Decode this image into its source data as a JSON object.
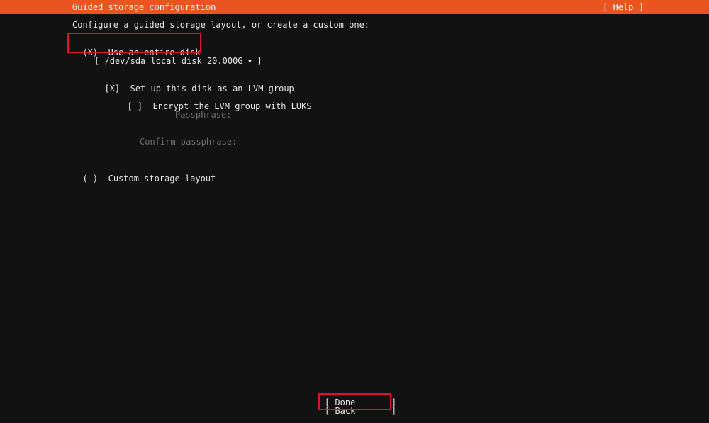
{
  "header": {
    "title": "Guided storage configuration",
    "help_label": "[ Help ]"
  },
  "intro": "Configure a guided storage layout, or create a custom one:",
  "options": {
    "entire_disk": {
      "radio": "(X)",
      "label": "Use an entire disk"
    },
    "disk_select": {
      "open": "[",
      "value": "/dev/sda local disk 20.000G",
      "caret": "▼",
      "close": "]"
    },
    "lvm": {
      "checkbox": "[X]",
      "label": "Set up this disk as an LVM group"
    },
    "luks": {
      "checkbox": "[ ]",
      "label": "Encrypt the LVM group with LUKS"
    },
    "passphrase_label": "Passphrase:",
    "confirm_passphrase_label": "Confirm passphrase:",
    "custom": {
      "radio": "( )",
      "label": "Custom storage layout"
    }
  },
  "footer": {
    "done_label": "[ Done       ]",
    "back_label": "[ Back       ]"
  },
  "colors": {
    "header_bg": "#e95420",
    "background": "#121212",
    "highlight": "#e0102e",
    "text": "#e6e6e6",
    "dim_text": "#6f6f6f"
  }
}
